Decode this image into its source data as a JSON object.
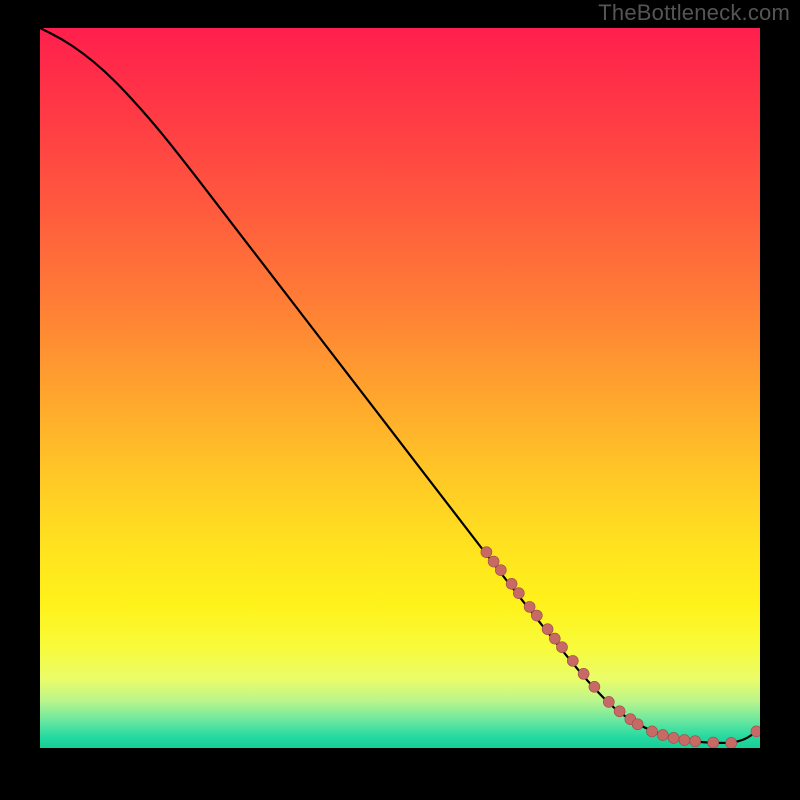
{
  "watermark": "TheBottleneck.com",
  "colors": {
    "background": "#000000",
    "gradient_stops": [
      {
        "offset": 0.0,
        "color": "#ff1f4d"
      },
      {
        "offset": 0.12,
        "color": "#ff3a45"
      },
      {
        "offset": 0.25,
        "color": "#ff5a3e"
      },
      {
        "offset": 0.38,
        "color": "#ff7d36"
      },
      {
        "offset": 0.5,
        "color": "#ffa22e"
      },
      {
        "offset": 0.62,
        "color": "#ffc726"
      },
      {
        "offset": 0.72,
        "color": "#ffe21f"
      },
      {
        "offset": 0.8,
        "color": "#fff21a"
      },
      {
        "offset": 0.86,
        "color": "#f8fb3a"
      },
      {
        "offset": 0.905,
        "color": "#e9fc6a"
      },
      {
        "offset": 0.935,
        "color": "#baf58c"
      },
      {
        "offset": 0.96,
        "color": "#6fe89f"
      },
      {
        "offset": 0.985,
        "color": "#24d9a1"
      },
      {
        "offset": 1.0,
        "color": "#18cf97"
      }
    ],
    "curve": "#000000",
    "marker_fill": "#c76a65",
    "marker_stroke": "#9e4a46"
  },
  "chart_data": {
    "type": "line",
    "title": "",
    "xlabel": "",
    "ylabel": "",
    "xlim": [
      0,
      100
    ],
    "ylim": [
      0,
      100
    ],
    "grid": false,
    "series": [
      {
        "name": "bottleneck-curve",
        "x": [
          0,
          3,
          6,
          9,
          12,
          16,
          20,
          25,
          30,
          35,
          40,
          45,
          50,
          55,
          60,
          65,
          70,
          75,
          78,
          80,
          82,
          84,
          86,
          88,
          90,
          92,
          94,
          96,
          98,
          99.5
        ],
        "y": [
          100,
          98.5,
          96.5,
          94,
          91,
          86.5,
          81.5,
          75,
          68.5,
          62,
          55.5,
          49,
          42.5,
          36,
          29.5,
          23,
          16.7,
          10.5,
          7.2,
          5.3,
          3.9,
          2.8,
          2.0,
          1.4,
          1.0,
          0.8,
          0.7,
          0.7,
          1.2,
          2.3
        ]
      }
    ],
    "markers": {
      "name": "highlighted-points",
      "x": [
        62,
        63,
        64,
        65.5,
        66.5,
        68,
        69,
        70.5,
        71.5,
        72.5,
        74,
        75.5,
        77,
        79,
        80.5,
        82,
        83,
        85,
        86.5,
        88,
        89.5,
        91,
        93.5,
        96,
        99.5
      ],
      "y": [
        27.2,
        25.9,
        24.7,
        22.8,
        21.5,
        19.6,
        18.4,
        16.5,
        15.2,
        14.0,
        12.1,
        10.3,
        8.5,
        6.4,
        5.1,
        4.0,
        3.3,
        2.3,
        1.8,
        1.4,
        1.1,
        0.95,
        0.75,
        0.7,
        2.3
      ]
    }
  }
}
